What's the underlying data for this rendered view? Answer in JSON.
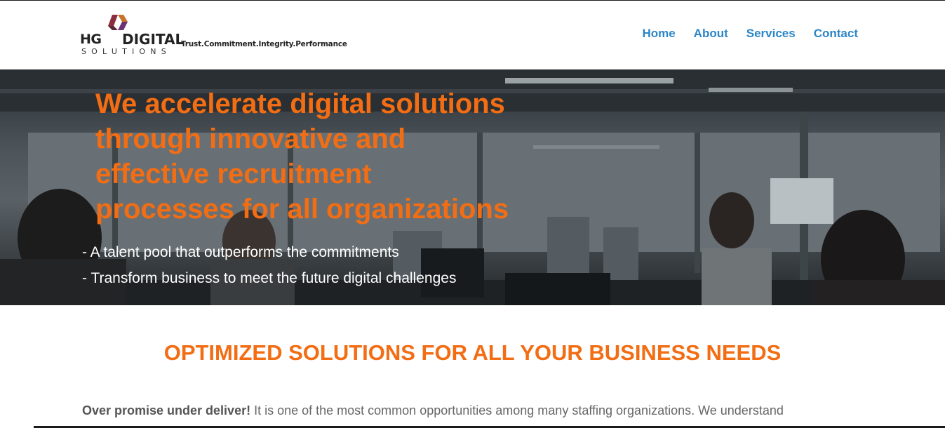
{
  "header": {
    "logo": {
      "hg": "HG",
      "digital": "DIGITAL",
      "solutions": "SOLUTIONS",
      "tagline": "Trust.Commitment.Integrity.Performance"
    },
    "nav": [
      {
        "label": "Home"
      },
      {
        "label": "About"
      },
      {
        "label": "Services"
      },
      {
        "label": "Contact"
      }
    ]
  },
  "hero": {
    "title_lines": [
      "We accelerate digital solutions",
      "through innovative and",
      "effective recruitment",
      "processes for all organizations"
    ],
    "points": [
      "- A talent pool that outperforms the commitments",
      "- Transform business to meet the future digital challenges"
    ]
  },
  "section": {
    "title": "OPTIMIZED SOLUTIONS FOR ALL YOUR BUSINESS NEEDS",
    "intro_bold": "Over promise under deliver!",
    "intro_text": " It is one of the most common opportunities among many staffing organizations. We understand"
  },
  "colors": {
    "accent": "#f26d13",
    "nav": "#2b86c8",
    "logo_mark_1": "#8b2d3f",
    "logo_mark_2": "#b35a1f"
  }
}
